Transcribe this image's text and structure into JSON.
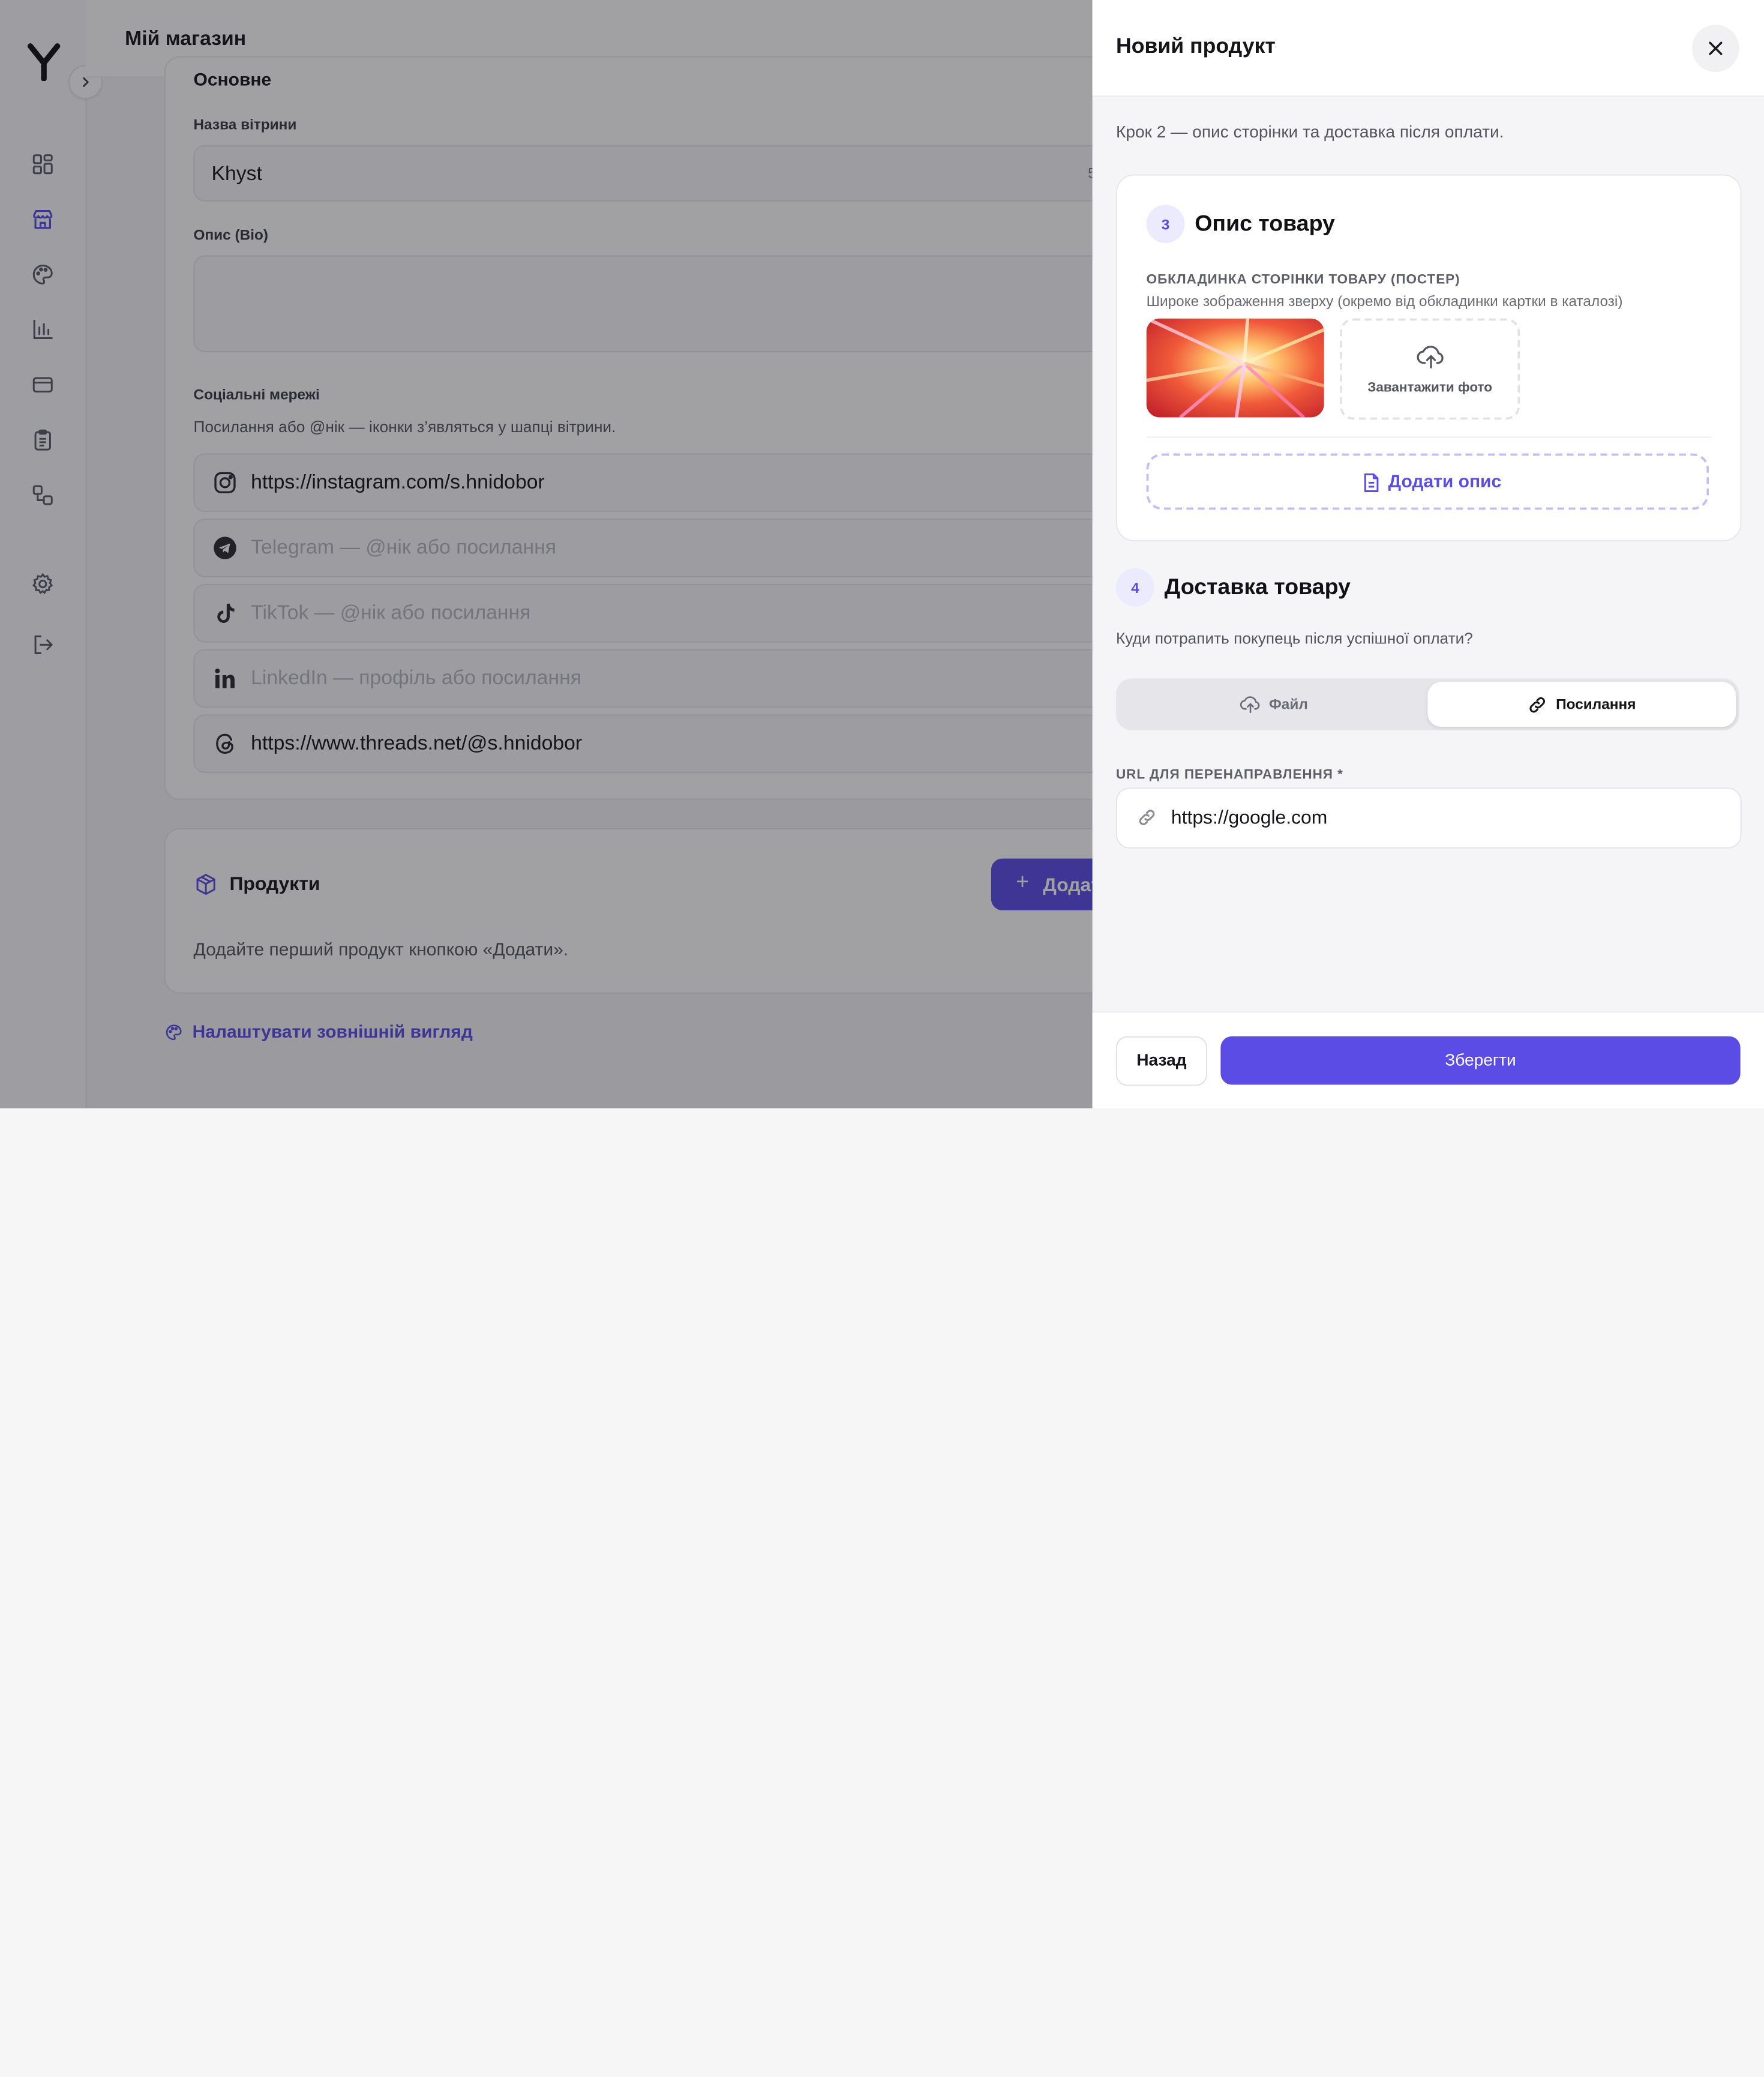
{
  "app": {
    "title": "Мій магазин"
  },
  "main": {
    "basics": {
      "heading": "Основне",
      "name_label": "Назва вітрини",
      "name_value": "Khyst",
      "name_counter": "5",
      "bio_label": "Опис (Bio)"
    },
    "social": {
      "heading": "Соціальні мережі",
      "hint": "Посилання або @нік — іконки з’являться у шапці вітрини.",
      "instagram_value": "https://instagram.com/s.hnidobor",
      "telegram_placeholder": "Telegram — @нік або посилання",
      "tiktok_placeholder": "TikTok — @нік або посилання",
      "linkedin_placeholder": "LinkedIn — профіль або посилання",
      "threads_value": "https://www.threads.net/@s.hnidobor"
    },
    "products": {
      "title": "Продукти",
      "add_label": "Додати",
      "empty_text": "Додайте перший продукт кнопкою «Додати»."
    },
    "appearance_link": "Налаштувати зовнішній вигляд"
  },
  "drawer": {
    "title": "Новий продукт",
    "step_caption": "Крок 2 — опис сторінки та доставка після оплати.",
    "description": {
      "step": "3",
      "title": "Опис товару",
      "cover_label": "ОБКЛАДИНКА СТОРІНКИ ТОВАРУ (ПОСТЕР)",
      "cover_hint": "Широке зображення зверху (окремо від обкладинки картки в каталозі)",
      "upload_label": "Завантажити фото",
      "add_description": "Додати опис"
    },
    "delivery": {
      "step": "4",
      "title": "Доставка товару",
      "question": "Куди потрапить покупець після успішної оплати?",
      "option_file": "Файл",
      "option_link": "Посилання",
      "url_label": "URL ДЛЯ ПЕРЕНАПРАВЛЕННЯ *",
      "url_value": "https://google.com"
    },
    "back_label": "Назад",
    "save_label": "Зберегти"
  },
  "colors": {
    "accent": "#5b4ce6",
    "accent_light": "#eceafd",
    "text": "#16161a",
    "muted": "#6b6b76"
  },
  "icons": {
    "sidebar": [
      "dashboard-icon",
      "store-icon",
      "palette-icon",
      "chart-icon",
      "card-icon",
      "clipboard-icon",
      "flow-icon",
      "settings-icon",
      "logout-icon"
    ]
  }
}
